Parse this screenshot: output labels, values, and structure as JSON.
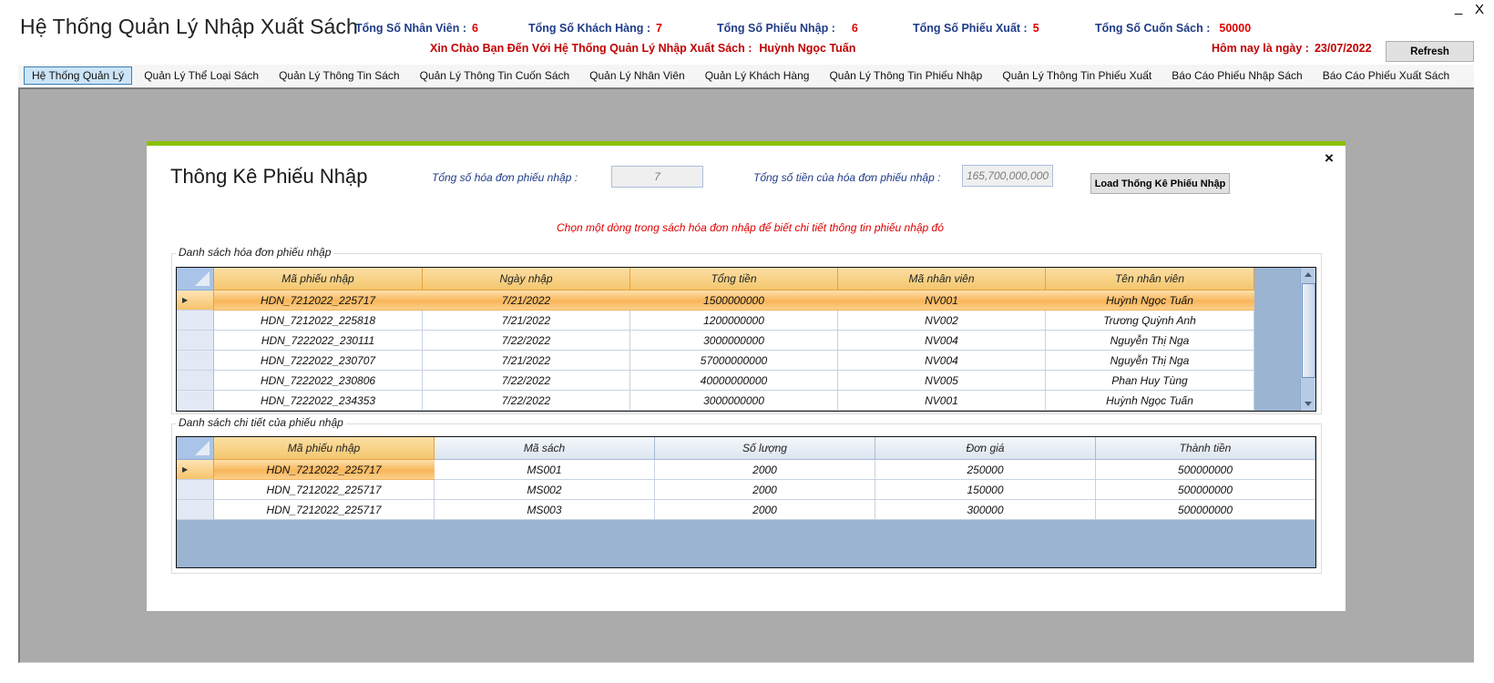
{
  "app": {
    "title": "Hệ Thống Quản Lý Nhập Xuất Sách",
    "window_controls": {
      "minimize": "_",
      "close": "X"
    }
  },
  "header": {
    "stats": [
      {
        "label": "Tổng Số Nhân Viên :",
        "value": "6"
      },
      {
        "label": "Tổng Số Khách Hàng :",
        "value": "7"
      },
      {
        "label": "Tổng Số Phiếu Nhập :",
        "value": "6"
      },
      {
        "label": "Tổng Số Phiếu Xuất :",
        "value": "5"
      },
      {
        "label": "Tổng Số Cuốn Sách :",
        "value": "50000"
      }
    ],
    "welcome_label": "Xin Chào Bạn Đến Với Hệ Thống Quản Lý Nhập Xuất Sách :",
    "welcome_user": "Huỳnh Ngọc Tuấn",
    "today_label": "Hôm nay là ngày :",
    "today_value": "23/07/2022",
    "refresh_label": "Refresh"
  },
  "menu": {
    "items": [
      {
        "label": "Hệ Thống Quản Lý",
        "active": true
      },
      {
        "label": "Quản Lý Thể Loại Sách"
      },
      {
        "label": "Quản Lý Thông Tin Sách"
      },
      {
        "label": "Quản Lý Thông Tin Cuốn Sách"
      },
      {
        "label": "Quản Lý Nhân Viên"
      },
      {
        "label": "Quản Lý Khách Hàng"
      },
      {
        "label": "Quản Lý Thông Tin Phiếu Nhập"
      },
      {
        "label": "Quản Lý Thông Tin Phiếu Xuất"
      },
      {
        "label": "Báo Cáo Phiếu Nhập Sách"
      },
      {
        "label": "Báo Cáo Phiếu Xuất Sách"
      }
    ]
  },
  "dialog": {
    "title": "Thông Kê Phiếu Nhập",
    "close_icon": "×",
    "invoice_count_label": "Tổng số hóa đơn phiếu nhập :",
    "invoice_count_value": "7",
    "total_amount_label": "Tổng số tiền của hóa đơn phiếu nhập :",
    "total_amount_value": "165,700,000,000",
    "load_button_label": "Load Thống Kê Phiếu Nhập",
    "hint": "Chọn một dòng trong sách hóa đơn nhập để biết chi tiết thông tin phiếu nhập đó",
    "invoices_group": {
      "title": "Danh sách hóa đơn phiếu nhập",
      "columns": [
        "Mã phiếu nhập",
        "Ngày nhập",
        "Tổng tiền",
        "Mã nhân viên",
        "Tên nhân viên"
      ],
      "rows": [
        [
          "HDN_7212022_225717",
          "7/21/2022",
          "1500000000",
          "NV001",
          "Huỳnh Ngọc Tuấn"
        ],
        [
          "HDN_7212022_225818",
          "7/21/2022",
          "1200000000",
          "NV002",
          "Trương Quỳnh Anh"
        ],
        [
          "HDN_7222022_230111",
          "7/22/2022",
          "3000000000",
          "NV004",
          "Nguyễn Thị Nga"
        ],
        [
          "HDN_7222022_230707",
          "7/21/2022",
          "57000000000",
          "NV004",
          "Nguyễn Thị Nga"
        ],
        [
          "HDN_7222022_230806",
          "7/22/2022",
          "40000000000",
          "NV005",
          "Phan Huy Tùng"
        ],
        [
          "HDN_7222022_234353",
          "7/22/2022",
          "3000000000",
          "NV001",
          "Huỳnh Ngọc Tuấn"
        ]
      ],
      "selected_row": 0
    },
    "details_group": {
      "title": "Danh sách chi tiết của phiếu nhập",
      "columns": [
        "Mã phiếu nhập",
        "Mã sách",
        "Số lượng",
        "Đơn giá",
        "Thành tiền"
      ],
      "rows": [
        [
          "HDN_7212022_225717",
          "MS001",
          "2000",
          "250000",
          "500000000"
        ],
        [
          "HDN_7212022_225717",
          "MS002",
          "2000",
          "150000",
          "500000000"
        ],
        [
          "HDN_7212022_225717",
          "MS003",
          "2000",
          "300000",
          "500000000"
        ]
      ],
      "selected_row": 0
    }
  }
}
